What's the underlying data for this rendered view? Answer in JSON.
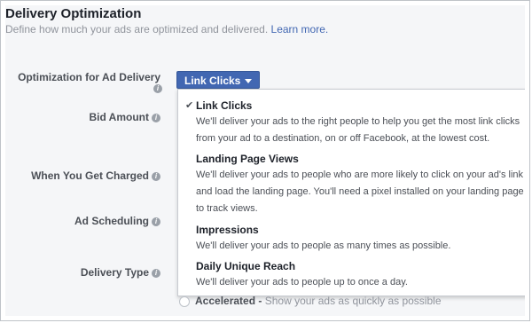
{
  "section": {
    "title": "Delivery Optimization",
    "description": "Define how much your ads are optimized and delivered.",
    "learn_more": "Learn more."
  },
  "labels": {
    "optimization": "Optimization for Ad Delivery",
    "bid_amount": "Bid Amount",
    "when_charged": "When You Get Charged",
    "ad_scheduling": "Ad Scheduling",
    "delivery_type": "Delivery Type"
  },
  "dropdown": {
    "selected": "Link Clicks",
    "options": [
      {
        "title": "Link Clicks",
        "line1": "We'll deliver your ads to the right people to help you get the most link clicks",
        "line2": "from your ad to a destination, on or off Facebook, at the lowest cost.",
        "selected": true
      },
      {
        "title": "Landing Page Views",
        "line1": "We'll deliver your ads to people who are more likely to click on your ad's link",
        "line2": "and load the landing page. You'll need a pixel installed on your landing page",
        "line3": "to track views."
      },
      {
        "title": "Impressions",
        "line1": "We'll deliver your ads to people as many times as possible."
      },
      {
        "title": "Daily Unique Reach",
        "line1": "We'll deliver your ads to people up to once a day."
      }
    ]
  },
  "accelerated": {
    "label": "Accelerated",
    "separator": " - ",
    "description": "Show your ads as quickly as possible"
  },
  "icons": {
    "info": "i",
    "check": "✔"
  },
  "colors": {
    "accent": "#4267b2",
    "panel": "#f5f6f8"
  }
}
